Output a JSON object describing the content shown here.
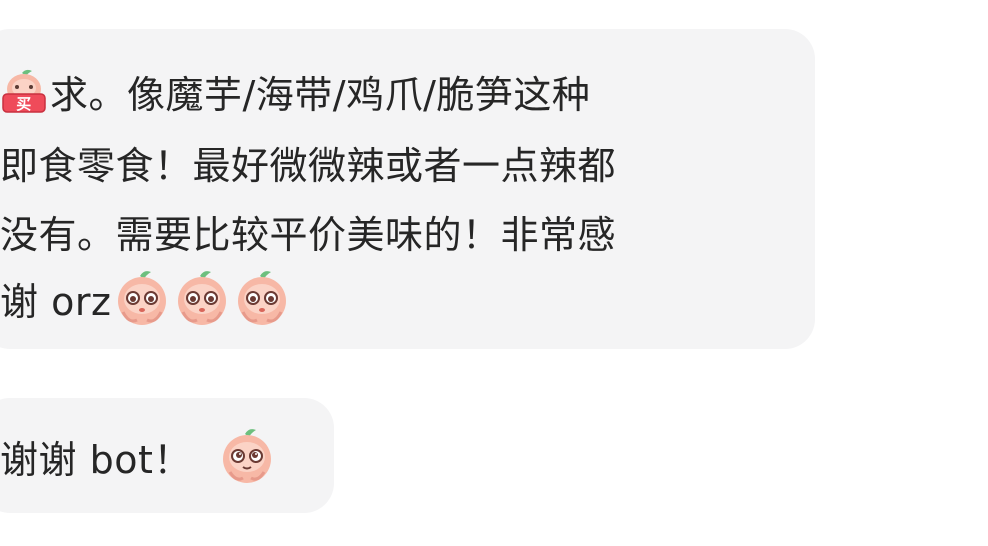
{
  "messages": [
    {
      "lines": [
        {
          "text": "求。像魔芋/海带/鸡爪/脆笋这种",
          "lead_emoji": "buy-peach-sticker",
          "lead_emoji_text": "买"
        },
        {
          "text": "即食零食！最好微微辣或者一点辣都"
        },
        {
          "text": "没有。需要比较平价美味的！非常感"
        },
        {
          "text": "谢 orz",
          "trail_emoji": "crying-peach-sticker",
          "trail_emoji_count": 3
        }
      ]
    },
    {
      "lines": [
        {
          "text": "谢谢 bot！",
          "trail_emoji": "pleading-peach-sticker"
        }
      ]
    }
  ],
  "colors": {
    "bubble_bg": "#f4f4f5",
    "text": "#262626",
    "peach_body": "#f7b8a6",
    "peach_leaf": "#6dbf7e",
    "buy_badge": "#ef4b5a"
  }
}
